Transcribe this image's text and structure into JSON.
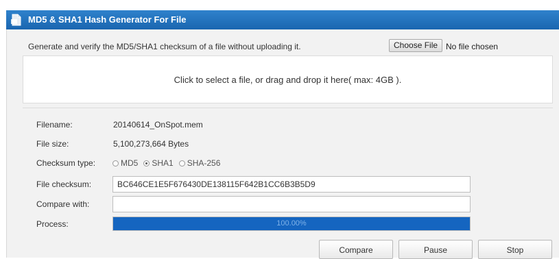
{
  "window": {
    "title": "MD5 & SHA1 Hash Generator For File"
  },
  "intro": {
    "description": "Generate and verify the MD5/SHA1 checksum of a file without uploading it.",
    "choose_file_label": "Choose File",
    "file_status": "No file chosen"
  },
  "dropzone": {
    "text": "Click to select a file, or drag and drop it here( max: 4GB )."
  },
  "details": {
    "filename_label": "Filename:",
    "filename_value": "20140614_OnSpot.mem",
    "filesize_label": "File size:",
    "filesize_value": "5,100,273,664 Bytes",
    "checksum_type_label": "Checksum type:",
    "checksum_options": [
      {
        "label": "MD5",
        "selected": false
      },
      {
        "label": "SHA1",
        "selected": true
      },
      {
        "label": "SHA-256",
        "selected": false
      }
    ],
    "file_checksum_label": "File checksum:",
    "file_checksum_value": "BC646CE1E5F676430DE138115F642B1CC6B3B5D9",
    "compare_label": "Compare with:",
    "compare_value": "",
    "process_label": "Process:",
    "process_fraction": 1.0,
    "process_text": "100.00%"
  },
  "actions": {
    "compare_label": "Compare",
    "pause_label": "Pause",
    "stop_label": "Stop"
  },
  "colors": {
    "title_bar": "#1f6fbf",
    "progress_fill": "#1565c0",
    "panel_bg": "#f2f2f2"
  }
}
